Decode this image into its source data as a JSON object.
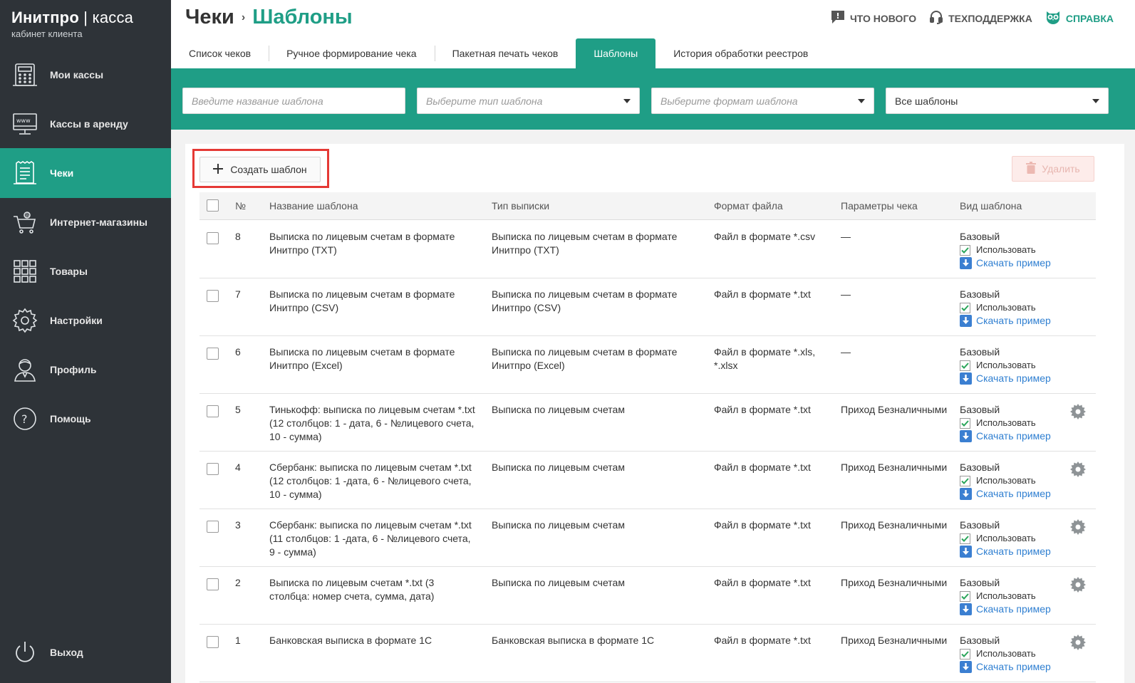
{
  "brand": {
    "title_bold": "Инитпро",
    "title_sep": "|",
    "title_thin": "касса",
    "subtitle": "кабинет клиента"
  },
  "sidebar": {
    "items": [
      {
        "label": "Мои кассы",
        "icon": "cash-register-icon"
      },
      {
        "label": "Кассы в аренду",
        "icon": "www-monitor-icon"
      },
      {
        "label": "Чеки",
        "icon": "receipt-icon",
        "active": true
      },
      {
        "label": "Интернет-магазины",
        "icon": "shopping-cart-icon"
      },
      {
        "label": "Товары",
        "icon": "grid-icon"
      },
      {
        "label": "Настройки",
        "icon": "gear-icon"
      },
      {
        "label": "Профиль",
        "icon": "user-icon"
      },
      {
        "label": "Помощь",
        "icon": "question-icon"
      }
    ],
    "logout": {
      "label": "Выход",
      "icon": "power-icon"
    }
  },
  "header": {
    "title": "Чеки",
    "separator": "›",
    "subtitle": "Шаблоны",
    "links": {
      "news": "ЧТО НОВОГО",
      "support": "ТЕХПОДДЕРЖКА",
      "help": "СПРАВКА"
    }
  },
  "tabs": [
    {
      "label": "Список чеков"
    },
    {
      "label": "Ручное формирование чека"
    },
    {
      "label": "Пакетная печать чеков"
    },
    {
      "label": "Шаблоны",
      "active": true
    },
    {
      "label": "История обработки реестров"
    }
  ],
  "filters": {
    "name_placeholder": "Введите название шаблона",
    "type_placeholder": "Выберите тип шаблона",
    "format_placeholder": "Выберите формат шаблона",
    "scope_value": "Все шаблоны"
  },
  "actions": {
    "create": "Создать шаблон",
    "delete": "Удалить"
  },
  "colors": {
    "accent": "#1f9e86",
    "sidebar": "#2e3338",
    "link": "#2f7fd1",
    "highlight": "#e53935"
  },
  "table": {
    "headers": {
      "num": "№",
      "name": "Название шаблона",
      "type": "Тип выписки",
      "format": "Формат файла",
      "params": "Параметры чека",
      "kind": "Вид шаблона"
    },
    "use_label": "Использовать",
    "download_label": "Скачать пример",
    "rows": [
      {
        "num": "8",
        "name": "Выписка по лицевым счетам в формате Инитпро (TXT)",
        "type": "Выписка по лицевым счетам в формате Инитпро (TXT)",
        "format": "Файл в формате *.csv",
        "params": "—",
        "kind": "Базовый",
        "gear": false
      },
      {
        "num": "7",
        "name": "Выписка по лицевым счетам в формате Инитпро (CSV)",
        "type": "Выписка по лицевым счетам в формате Инитпро (CSV)",
        "format": "Файл в формате *.txt",
        "params": "—",
        "kind": "Базовый",
        "gear": false
      },
      {
        "num": "6",
        "name": "Выписка по лицевым счетам в формате Инитпро (Excel)",
        "type": "Выписка по лицевым счетам в формате Инитпро (Excel)",
        "format": "Файл в формате *.xls, *.xlsx",
        "params": "—",
        "kind": "Базовый",
        "gear": false
      },
      {
        "num": "5",
        "name": "Тинькофф: выписка по лицевым счетам *.txt (12 столбцов: 1 - дата, 6 - №лицевого счета, 10 - сумма)",
        "type": "Выписка по лицевым счетам",
        "format": "Файл в формате *.txt",
        "params": "Приход Безналичными",
        "kind": "Базовый",
        "gear": true
      },
      {
        "num": "4",
        "name": "Сбербанк: выписка по лицевым счетам *.txt (12 столбцов: 1 -дата, 6 - №лицевого счета, 10 - сумма)",
        "type": "Выписка по лицевым счетам",
        "format": "Файл в формате *.txt",
        "params": "Приход Безналичными",
        "kind": "Базовый",
        "gear": true
      },
      {
        "num": "3",
        "name": "Сбербанк: выписка по лицевым счетам *.txt (11 столбцов: 1 -дата, 6 - №лицевого счета, 9 - сумма)",
        "type": "Выписка по лицевым счетам",
        "format": "Файл в формате *.txt",
        "params": "Приход Безналичными",
        "kind": "Базовый",
        "gear": true
      },
      {
        "num": "2",
        "name": "Выписка по лицевым счетам *.txt (3 столбца: номер счета, сумма, дата)",
        "type": "Выписка по лицевым счетам",
        "format": "Файл в формате *.txt",
        "params": "Приход Безналичными",
        "kind": "Базовый",
        "gear": true
      },
      {
        "num": "1",
        "name": "Банковская выписка в формате 1С",
        "type": "Банковская выписка в формате 1С",
        "format": "Файл в формате *.txt",
        "params": "Приход Безналичными",
        "kind": "Базовый",
        "gear": true
      }
    ]
  }
}
